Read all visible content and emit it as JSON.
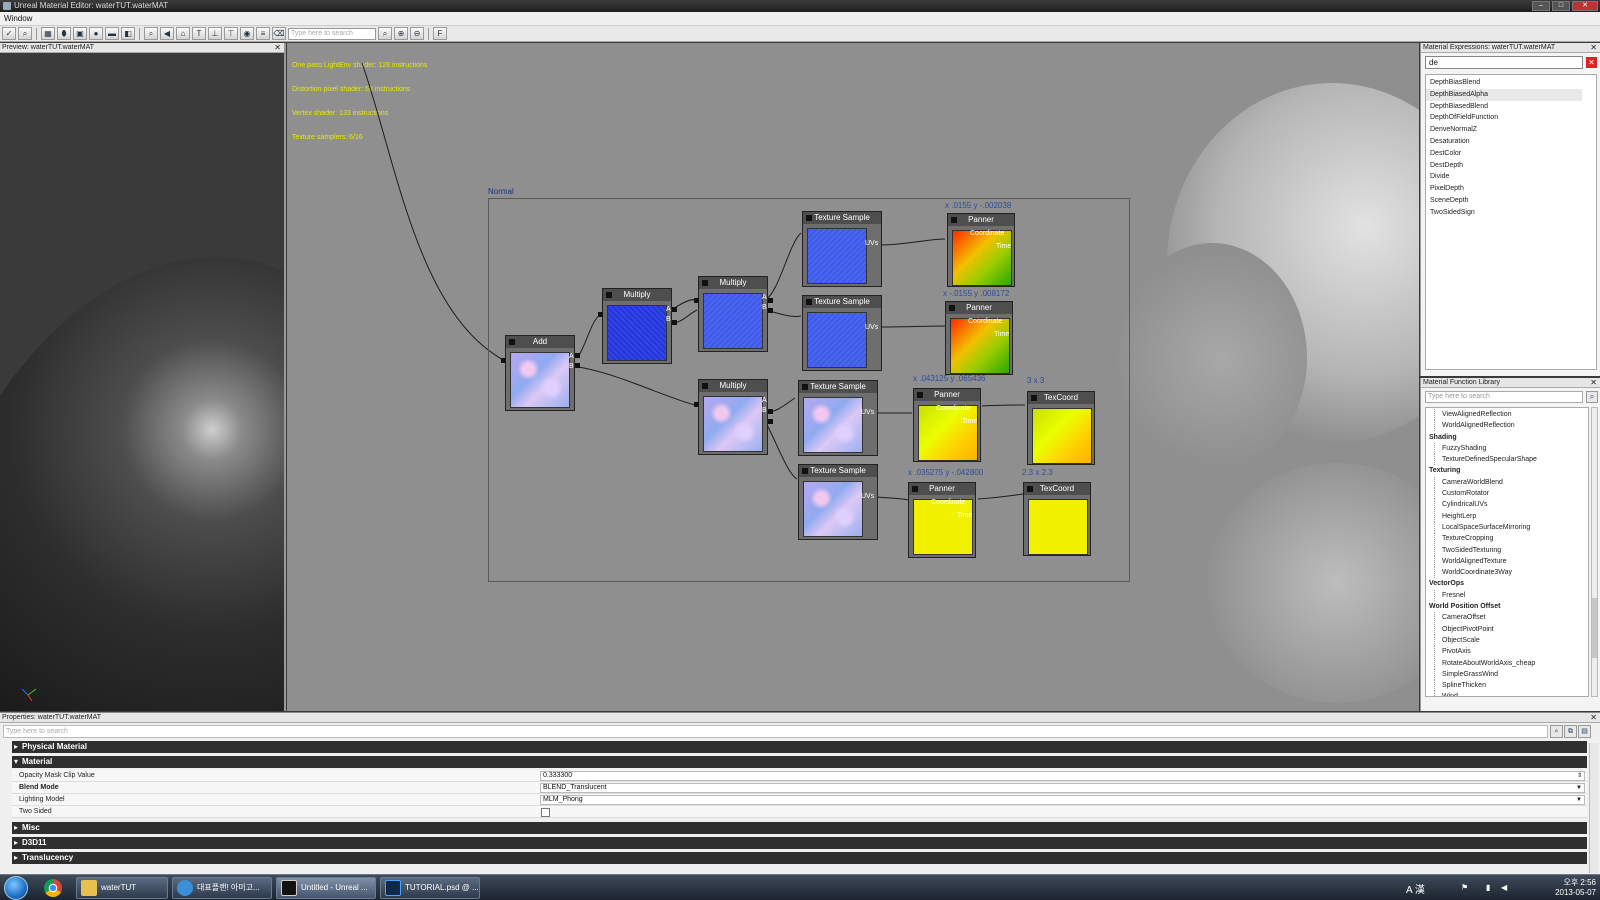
{
  "window": {
    "title": "Unreal Material Editor: waterTUT.waterMAT"
  },
  "menu": {
    "window": "Window"
  },
  "toolbar": {
    "search_placeholder": "Type here to search"
  },
  "preview": {
    "title": "Preview: waterTUT.waterMAT",
    "close": "✕"
  },
  "graph": {
    "stats": [
      "One pass LightEnv shader: 128 instructions",
      "Distortion pixel shader: 53 instructions",
      "Vertex shader: 133 instructions",
      "Texture samplers: 6/16"
    ],
    "comment_label": "Normal",
    "nodes": {
      "add": "Add",
      "multiply1": "Multiply",
      "multiply2": "Multiply",
      "multiply3": "Multiply",
      "texsample1": "Texture Sample",
      "texsample2": "Texture Sample",
      "texsample3": "Texture Sample",
      "texsample4": "Texture Sample",
      "panner1": "Panner",
      "panner2": "Panner",
      "panner3": "Panner",
      "panner4": "Panner",
      "texcoord1": "TexCoord",
      "texcoord2": "TexCoord"
    },
    "pins": {
      "uvs": "UVs",
      "coordinate": "Coordinate",
      "time": "Time",
      "a": "A",
      "b": "B"
    },
    "coords": {
      "panner1": "x .0155 y -.002038",
      "panner2": "x -.0155 y .008172",
      "panner3": "x .043125 y .065436",
      "panner4": "x .035275 y -.042800",
      "texcoord1": "3 x 3",
      "texcoord2": "2.3 x 2.3"
    }
  },
  "expressions": {
    "title": "Material Expressions: waterTUT.waterMAT",
    "search_value": "de",
    "clear": "✕",
    "items": [
      "DepthBiasBlend",
      "DepthBiasedAlpha",
      "DepthBiasedBlend",
      "DepthOfFieldFunction",
      "DeriveNormalZ",
      "Desaturation",
      "DestColor",
      "DestDepth",
      "Divide",
      "PixelDepth",
      "SceneDepth",
      "TwoSidedSign"
    ],
    "selected_index": 1
  },
  "functions": {
    "title": "Material Function Library",
    "search_placeholder": "Type here to search",
    "tree": [
      {
        "kind": "leaf",
        "label": "ViewAlignedReflection"
      },
      {
        "kind": "leaf",
        "label": "WorldAlignedReflection"
      },
      {
        "kind": "cat",
        "label": "Shading"
      },
      {
        "kind": "leaf",
        "label": "FuzzyShading"
      },
      {
        "kind": "leaf",
        "label": "TextureDefinedSpecularShape"
      },
      {
        "kind": "cat",
        "label": "Texturing"
      },
      {
        "kind": "leaf",
        "label": "CameraWorldBlend"
      },
      {
        "kind": "leaf",
        "label": "CustomRotator"
      },
      {
        "kind": "leaf",
        "label": "CylindricalUVs"
      },
      {
        "kind": "leaf",
        "label": "HeightLerp"
      },
      {
        "kind": "leaf",
        "label": "LocalSpaceSurfaceMirroring"
      },
      {
        "kind": "leaf",
        "label": "TextureCropping"
      },
      {
        "kind": "leaf",
        "label": "TwoSidedTexturing"
      },
      {
        "kind": "leaf",
        "label": "WorldAlignedTexture"
      },
      {
        "kind": "leaf",
        "label": "WorldCoordinate3Way"
      },
      {
        "kind": "cat",
        "label": "VectorOps"
      },
      {
        "kind": "leaf",
        "label": "Fresnel"
      },
      {
        "kind": "cat",
        "label": "World Position Offset"
      },
      {
        "kind": "leaf",
        "label": "CameraOffset"
      },
      {
        "kind": "leaf",
        "label": "ObjectPivotPoint"
      },
      {
        "kind": "leaf",
        "label": "ObjectScale"
      },
      {
        "kind": "leaf",
        "label": "PivotAxis"
      },
      {
        "kind": "leaf",
        "label": "RotateAboutWorldAxis_cheap"
      },
      {
        "kind": "leaf",
        "label": "SimpleGrassWind"
      },
      {
        "kind": "leaf",
        "label": "SplineThicken"
      },
      {
        "kind": "leaf",
        "label": "Wind"
      }
    ]
  },
  "properties": {
    "title": "Properties: waterTUT.waterMAT",
    "search_placeholder": "Type here to search",
    "categories": {
      "physical_material": "Physical Material",
      "material": "Material",
      "misc": "Misc",
      "d3d11": "D3D11",
      "translucency": "Translucency"
    },
    "rows": {
      "opacity_mask_label": "Opacity Mask Clip Value",
      "opacity_mask_value": "0.333300",
      "blend_mode_label": "Blend Mode",
      "blend_mode_value": "BLEND_Translucent",
      "lighting_model_label": "Lighting Model",
      "lighting_model_value": "MLM_Phong",
      "two_sided_label": "Two Sided"
    }
  },
  "taskbar": {
    "tasks": [
      "waterTUT",
      "대표플랜! 아미고...",
      "Untitled - Unreal ...",
      "TUTORIAL.psd @ ..."
    ],
    "tray_ime": "A 漢",
    "time": "오후 2:56",
    "date": "2013-05-07"
  }
}
